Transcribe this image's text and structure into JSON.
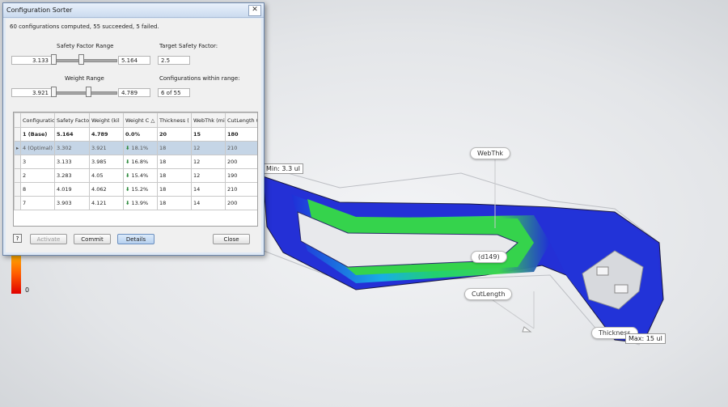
{
  "dialog": {
    "title": "Configuration Sorter",
    "summary": "60 configurations computed, 55 succeeded, 5 failed.",
    "safety_factor_range": {
      "label": "Safety Factor Range",
      "min": "3.133",
      "max": "5.164"
    },
    "weight_range": {
      "label": "Weight Range",
      "min": "3.921",
      "max": "4.789"
    },
    "target_safety_factor": {
      "label": "Target Safety Factor:",
      "value": "2.5"
    },
    "configs_within_range": {
      "label": "Configurations within range:",
      "value": "6 of 55"
    },
    "table": {
      "columns": [
        "Configuratic",
        "Safety Facto",
        "Weight (kil",
        "Weight C △",
        "Thickness (",
        "WebThk (mi",
        "CutLength ("
      ],
      "rows": [
        {
          "config": "1 (Base)",
          "safety": "5.164",
          "weight": "4.789",
          "weight_change": "0.0%",
          "thickness": "20",
          "webthk": "15",
          "cutlength": "180"
        },
        {
          "config": "4 (Optimal)",
          "safety": "3.302",
          "weight": "3.921",
          "weight_change": "18.1%",
          "thickness": "18",
          "webthk": "12",
          "cutlength": "210"
        },
        {
          "config": "3",
          "safety": "3.133",
          "weight": "3.985",
          "weight_change": "16.8%",
          "thickness": "18",
          "webthk": "12",
          "cutlength": "200"
        },
        {
          "config": "2",
          "safety": "3.283",
          "weight": "4.05",
          "weight_change": "15.4%",
          "thickness": "18",
          "webthk": "12",
          "cutlength": "190"
        },
        {
          "config": "8",
          "safety": "4.019",
          "weight": "4.062",
          "weight_change": "15.2%",
          "thickness": "18",
          "webthk": "14",
          "cutlength": "210"
        },
        {
          "config": "7",
          "safety": "3.903",
          "weight": "4.121",
          "weight_change": "13.9%",
          "thickness": "18",
          "webthk": "14",
          "cutlength": "200"
        }
      ]
    },
    "buttons": {
      "help": "?",
      "activate": "Activate",
      "commit": "Commit",
      "details": "Details",
      "close": "Close"
    }
  },
  "viewport": {
    "callouts": {
      "webthk": "WebThk",
      "d149": "(d149)",
      "cutlength": "CutLength",
      "thickness": "Thickness"
    },
    "min_tag": "Min: 3.3 ul",
    "max_tag": "Max: 15 ul",
    "legend_zero": "0"
  }
}
